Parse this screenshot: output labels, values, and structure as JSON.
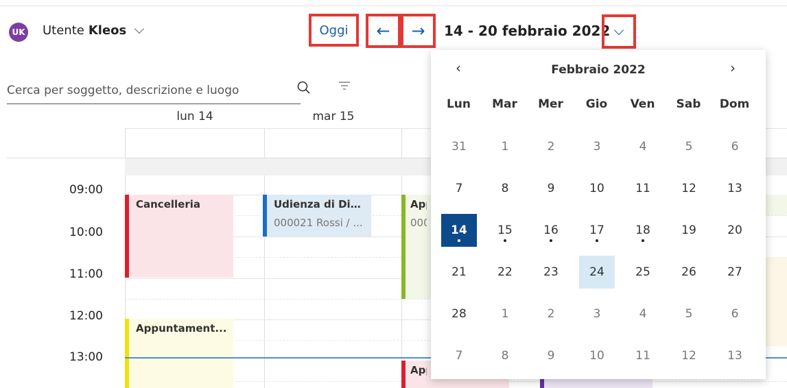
{
  "header": {
    "avatar_initials": "UK",
    "user_prefix": "Utente",
    "user_name": "Kleos",
    "today_label": "Oggi",
    "prev_arrow": "←",
    "next_arrow": "→",
    "date_range": "14 - 20 febbraio 2022"
  },
  "search": {
    "placeholder": "Cerca per soggetto, descrizione e luogo"
  },
  "calendar": {
    "day_headers": [
      "lun 14",
      "mar 15"
    ],
    "hours": [
      "09:00",
      "10:00",
      "11:00",
      "12:00",
      "13:00"
    ],
    "events": {
      "cancelleria": {
        "title": "Cancelleria",
        "bar_color": "#dc1f2d",
        "bg_color": "#fbe4e8"
      },
      "udienza": {
        "title": "Udienza di Dis...",
        "subtitle": "000021 Rossi / ...",
        "bar_color": "#1b6fc2",
        "bg_color": "#deeaf4"
      },
      "app_wed": {
        "title": "App",
        "subtitle": "000",
        "bar_color": "#86b825",
        "bg_color": "#f3f7e8"
      },
      "appuntamento": {
        "title": "Appuntament...",
        "bar_color": "#f2e20c",
        "bg_color": "#fdfbe3"
      },
      "app_wed2": {
        "title": "App",
        "bar_color": "#dc1f2d",
        "bg_color": "#fbe4e8"
      }
    }
  },
  "datepicker": {
    "month_label": "Febbraio 2022",
    "prev_icon": "‹",
    "next_icon": "›",
    "weekdays": [
      "Lun",
      "Mar",
      "Mer",
      "Gio",
      "Ven",
      "Sab",
      "Dom"
    ],
    "weeks": [
      [
        {
          "d": "31",
          "other": true
        },
        {
          "d": "1",
          "other": true
        },
        {
          "d": "2",
          "other": true
        },
        {
          "d": "3",
          "other": true
        },
        {
          "d": "4",
          "other": true
        },
        {
          "d": "5",
          "other": true
        },
        {
          "d": "6",
          "other": true
        }
      ],
      [
        {
          "d": "7"
        },
        {
          "d": "8"
        },
        {
          "d": "9"
        },
        {
          "d": "10"
        },
        {
          "d": "11"
        },
        {
          "d": "12"
        },
        {
          "d": "13"
        }
      ],
      [
        {
          "d": "14",
          "selected": true,
          "dot": true
        },
        {
          "d": "15",
          "dot": true
        },
        {
          "d": "16",
          "dot": true
        },
        {
          "d": "17",
          "dot": true
        },
        {
          "d": "18",
          "dot": true
        },
        {
          "d": "19"
        },
        {
          "d": "20"
        }
      ],
      [
        {
          "d": "21"
        },
        {
          "d": "22"
        },
        {
          "d": "23"
        },
        {
          "d": "24",
          "highlight": true
        },
        {
          "d": "25"
        },
        {
          "d": "26"
        },
        {
          "d": "27"
        }
      ],
      [
        {
          "d": "28"
        },
        {
          "d": "1",
          "other": true
        },
        {
          "d": "2",
          "other": true
        },
        {
          "d": "3",
          "other": true
        },
        {
          "d": "4",
          "other": true
        },
        {
          "d": "5",
          "other": true
        },
        {
          "d": "6",
          "other": true
        }
      ],
      [
        {
          "d": "7",
          "other": true
        },
        {
          "d": "8",
          "other": true
        },
        {
          "d": "9",
          "other": true
        },
        {
          "d": "10",
          "other": true
        },
        {
          "d": "11",
          "other": true
        },
        {
          "d": "12",
          "other": true
        },
        {
          "d": "13",
          "other": true
        }
      ]
    ]
  },
  "colors": {
    "accent": "#1a5ea8",
    "highlight_box": "#e03a36",
    "selected_day": "#0d4a8c",
    "now_line": "#4f8fd0"
  }
}
